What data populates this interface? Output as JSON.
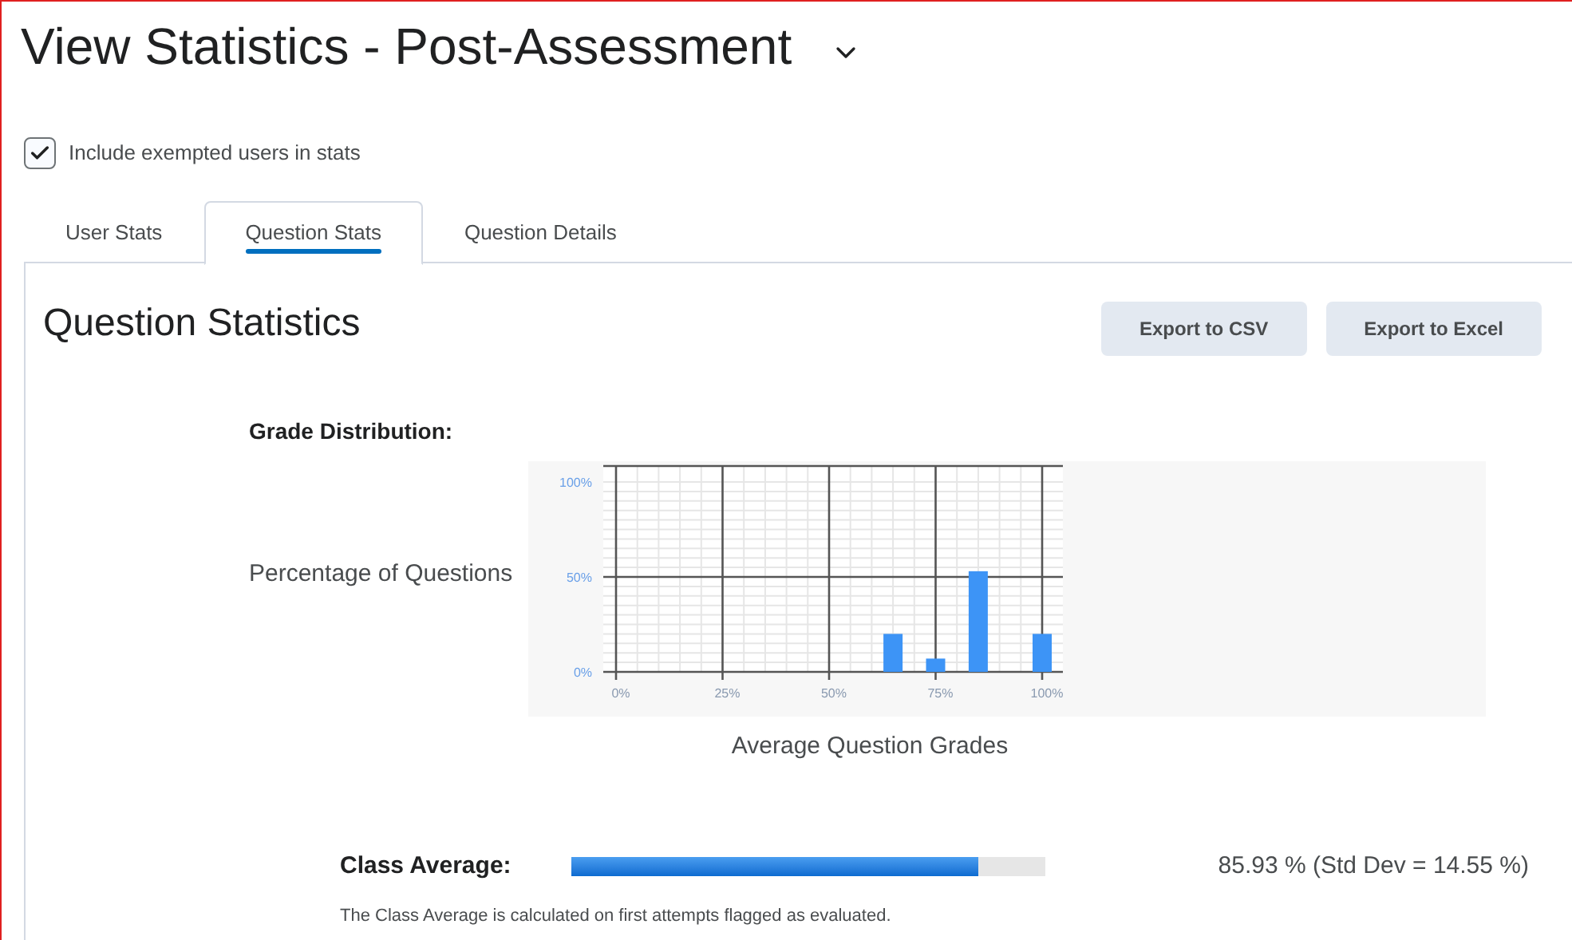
{
  "page": {
    "title": "View Statistics - Post-Assessment"
  },
  "include_exempted": {
    "label": "Include exempted users in stats",
    "checked": true
  },
  "tabs": [
    {
      "label": "User Stats",
      "selected": false
    },
    {
      "label": "Question Stats",
      "selected": true
    },
    {
      "label": "Question Details",
      "selected": false
    }
  ],
  "panel": {
    "heading": "Question Statistics",
    "buttons": [
      "Export to CSV",
      "Export to Excel"
    ],
    "grade_distribution": {
      "title": "Grade Distribution:",
      "chart_data": {
        "type": "bar",
        "grid": true,
        "xlabel": "Average Question Grades",
        "ylabel": "Percentage of Questions",
        "x": [
          65,
          75,
          85,
          100
        ],
        "values": [
          20,
          7,
          53,
          20
        ],
        "xlim": [
          0,
          100
        ],
        "ylim": [
          0,
          100
        ],
        "xticks": [
          {
            "value": 0,
            "label": "0%"
          },
          {
            "value": 25,
            "label": "25%"
          },
          {
            "value": 50,
            "label": "50%"
          },
          {
            "value": 75,
            "label": "75%"
          },
          {
            "value": 100,
            "label": "100%"
          }
        ],
        "yticks": [
          {
            "value": 0,
            "label": "0%"
          },
          {
            "value": 50,
            "label": "50%"
          },
          {
            "value": 100,
            "label": "100%"
          }
        ]
      }
    },
    "class_average": {
      "label": "Class Average:",
      "level": 0.86,
      "reading": "85.93 % (Std Dev = 14.55 %)",
      "note": "The Class Average is calculated on first attempts flagged as evaluated."
    }
  }
}
